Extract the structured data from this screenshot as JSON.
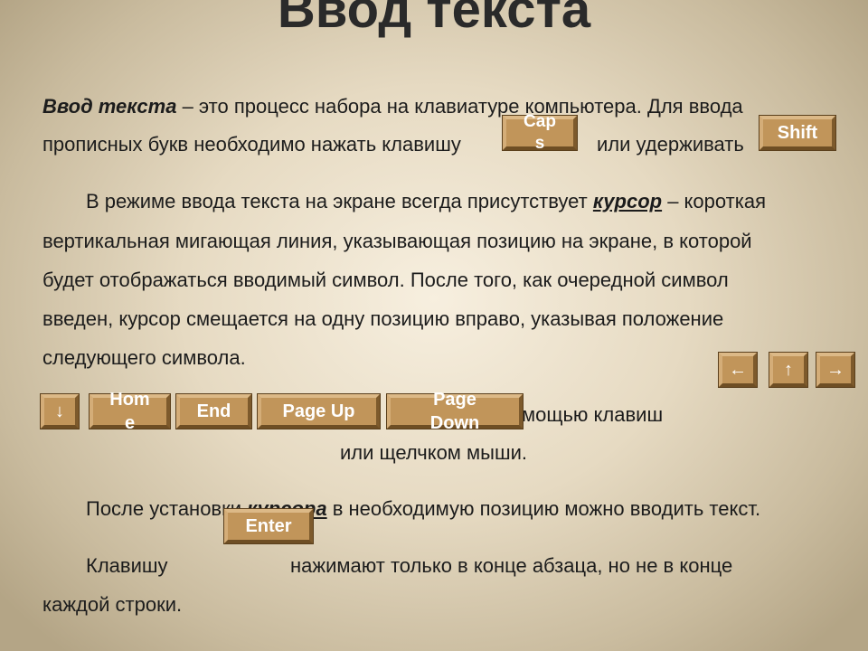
{
  "title": "Ввод текста",
  "p1": {
    "term": "Ввод текста",
    "l1": " – это процесс набора на клавиатуре компьютера. Для ввода",
    "l2a": "прописных букв необходимо нажать клавишу",
    "l2b": "или удерживать"
  },
  "p2": {
    "l1a": "В режиме ввода текста на экране всегда присутствует ",
    "term": "курсор",
    "l1b": " – короткая",
    "l2": "вертикальная мигающая линия, указывающая позицию на экране, в которой",
    "l3": "будет отображаться вводимый символ. После того, как очередной символ",
    "l4": "введен, курсор смещается на одну позицию вправо, указывая положение",
    "l5": "следующего символа."
  },
  "p3": {
    "l1": "мощью клавиш",
    "l2": "или щелчком мыши."
  },
  "p4": {
    "a": "После установки ",
    "term": "курсора",
    "b": " в необходимую позицию можно вводить текст."
  },
  "p5": {
    "a": "Клавишу",
    "b": "нажимают только в конце абзаца, но не в конце",
    "l2": "каждой строки."
  },
  "keys": {
    "caps": "Cap s",
    "shift": "Shift",
    "left": "←",
    "up": "↑",
    "right": "→",
    "down": "↓",
    "home": "Hom e",
    "end": "End",
    "pageup": "Page Up",
    "pagedown": "Page Down",
    "enter": "Enter"
  },
  "colors": {
    "key": "#c1955a",
    "key_text": "#ffffff"
  }
}
